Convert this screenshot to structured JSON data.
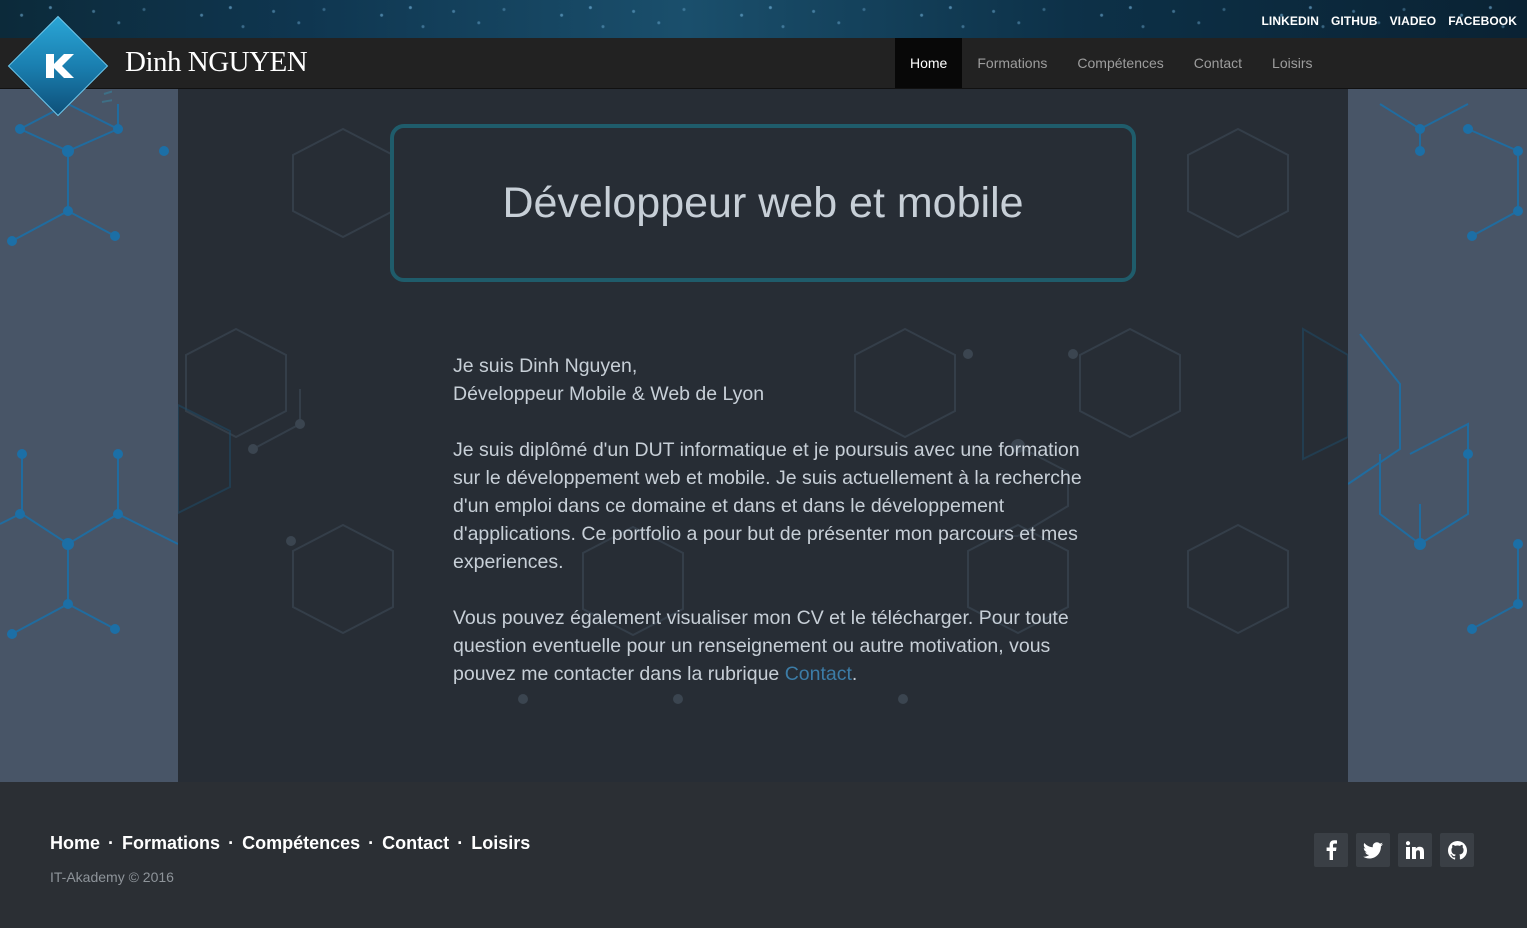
{
  "top_social": [
    "LINKEDIN",
    "GITHUB",
    "VIADEO",
    "FACEBOOK"
  ],
  "brand": {
    "name": "Dinh NGUYEN",
    "logo_icon": "k-diamond-logo-icon"
  },
  "nav": {
    "items": [
      "Home",
      "Formations",
      "Compétences",
      "Contact",
      "Loisirs"
    ],
    "active": "Home"
  },
  "hero": {
    "title": "Développeur web et mobile"
  },
  "intro": {
    "line1": "Je suis Dinh Nguyen,",
    "line2": "Développeur Mobile & Web de Lyon",
    "para2": "Je suis diplômé d'un DUT informatique et je poursuis avec une formation sur le développement web et mobile. Je suis actuellement à la recherche d'un emploi dans ce domaine et dans et dans le développement d'applications. Ce portfolio a pour but de présenter mon parcours et mes experiences.",
    "para3_before": "Vous pouvez également visualiser mon CV et le télécharger. Pour toute question eventuelle pour un renseignement ou autre motivation, vous pouvez me contacter dans la rubrique ",
    "para3_link": "Contact",
    "para3_after": "."
  },
  "footer": {
    "links": [
      "Home",
      "Formations",
      "Compétences",
      "Contact",
      "Loisirs"
    ],
    "separator": "·",
    "copyright": "IT-Akademy © 2016",
    "social_icons": [
      "facebook-icon",
      "twitter-icon",
      "linkedin-icon",
      "github-icon"
    ]
  },
  "colors": {
    "accent": "#1f5c6b",
    "link": "#3c7ca6",
    "nav_bg": "#222222",
    "content_bg": "#272d35",
    "side_bg": "#485567"
  }
}
